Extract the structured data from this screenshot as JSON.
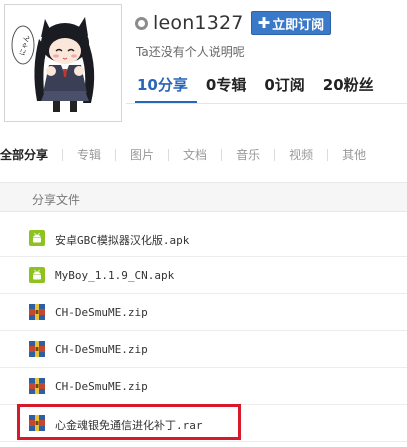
{
  "profile": {
    "username": "leon1327",
    "subscribe_label": "立即订阅",
    "bio": "Ta还没有个人说明呢",
    "stats": [
      {
        "count": "10",
        "label": "分享"
      },
      {
        "count": "0",
        "label": "专辑"
      },
      {
        "count": "0",
        "label": "订阅"
      },
      {
        "count": "20",
        "label": "粉丝"
      }
    ],
    "avatar_bubble_text": "にゃん"
  },
  "tabs": [
    "全部分享",
    "专辑",
    "图片",
    "文档",
    "音乐",
    "视频",
    "其他"
  ],
  "list": {
    "header": "分享文件",
    "files": [
      {
        "name": "安卓GBC模拟器汉化版.apk",
        "icon": "android-apk-icon"
      },
      {
        "name": "MyBoy_1.1.9_CN.apk",
        "icon": "android-apk-icon"
      },
      {
        "name": "CH-DeSmuME.zip",
        "icon": "archive-icon"
      },
      {
        "name": "CH-DeSmuME.zip",
        "icon": "archive-icon"
      },
      {
        "name": "CH-DeSmuME.zip",
        "icon": "archive-icon"
      },
      {
        "name": "心金魂银免通信进化补丁.rar",
        "icon": "archive-icon"
      }
    ]
  },
  "colors": {
    "accent": "#2966b8",
    "button": "#3a78c8",
    "apk_icon": "#8dc21f",
    "highlight": "#d8192b"
  }
}
